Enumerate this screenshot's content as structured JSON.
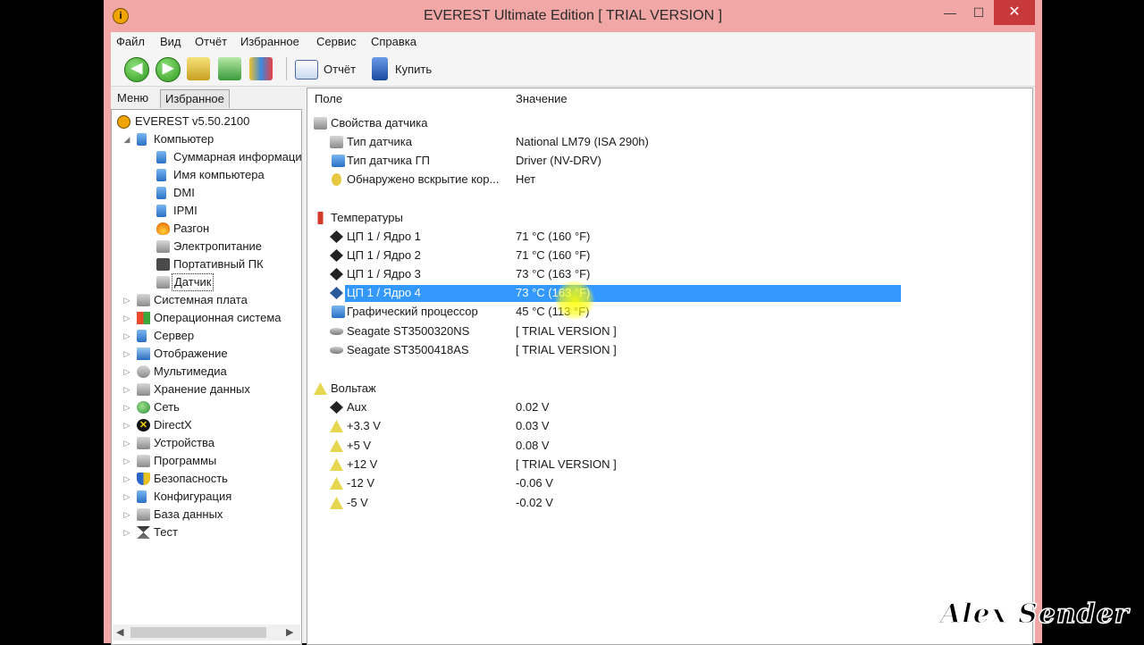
{
  "window": {
    "title": "EVEREST Ultimate Edition  [ TRIAL VERSION ]",
    "controls": {
      "minimize": "—",
      "maximize": "☐",
      "close": "✕"
    }
  },
  "menu": [
    "Файл",
    "Вид",
    "Отчёт",
    "Избранное",
    "Сервис",
    "Справка"
  ],
  "toolbar": {
    "report_label": "Отчёт",
    "buy_label": "Купить"
  },
  "tabs": {
    "menu": "Меню",
    "favorites": "Избранное"
  },
  "tree": {
    "root": "EVEREST v5.50.2100",
    "computer": "Компьютер",
    "computer_children": [
      "Суммарная информация",
      "Имя компьютера",
      "DMI",
      "IPMI",
      "Разгон",
      "Электропитание",
      "Портативный ПК",
      "Датчик"
    ],
    "sections": [
      "Системная плата",
      "Операционная система",
      "Сервер",
      "Отображение",
      "Мультимедиа",
      "Хранение данных",
      "Сеть",
      "DirectX",
      "Устройства",
      "Программы",
      "Безопасность",
      "Конфигурация",
      "База данных",
      "Тест"
    ]
  },
  "columns": {
    "field": "Поле",
    "value": "Значение"
  },
  "groups": {
    "sensor": {
      "title": "Свойства датчика",
      "rows": [
        {
          "field": "Тип датчика",
          "value": "National LM79  (ISA 290h)"
        },
        {
          "field": "Тип датчика ГП",
          "value": "Driver  (NV-DRV)"
        },
        {
          "field": "Обнаружено вскрытие кор...",
          "value": "Нет"
        }
      ]
    },
    "temps": {
      "title": "Температуры",
      "rows": [
        {
          "field": "ЦП 1 / Ядро 1",
          "value": "71 °C  (160 °F)"
        },
        {
          "field": "ЦП 1 / Ядро 2",
          "value": "71 °C  (160 °F)"
        },
        {
          "field": "ЦП 1 / Ядро 3",
          "value": "73 °C  (163 °F)"
        },
        {
          "field": "ЦП 1 / Ядро 4",
          "value": "73 °C  (163 °F)"
        },
        {
          "field": "Графический процессор",
          "value": "45 °C  (113 °F)"
        },
        {
          "field": "Seagate ST3500320NS",
          "value": "[ TRIAL VERSION ]"
        },
        {
          "field": "Seagate ST3500418AS",
          "value": "[ TRIAL VERSION ]"
        }
      ]
    },
    "voltage": {
      "title": "Вольтаж",
      "rows": [
        {
          "field": "Aux",
          "value": "0.02 V"
        },
        {
          "field": "+3.3 V",
          "value": "0.03 V"
        },
        {
          "field": "+5 V",
          "value": "0.08 V"
        },
        {
          "field": "+12 V",
          "value": "[ TRIAL VERSION ]"
        },
        {
          "field": "-12 V",
          "value": "-0.06 V"
        },
        {
          "field": "-5 V",
          "value": "-0.02 V"
        }
      ]
    }
  },
  "watermark": "Alex Sender"
}
